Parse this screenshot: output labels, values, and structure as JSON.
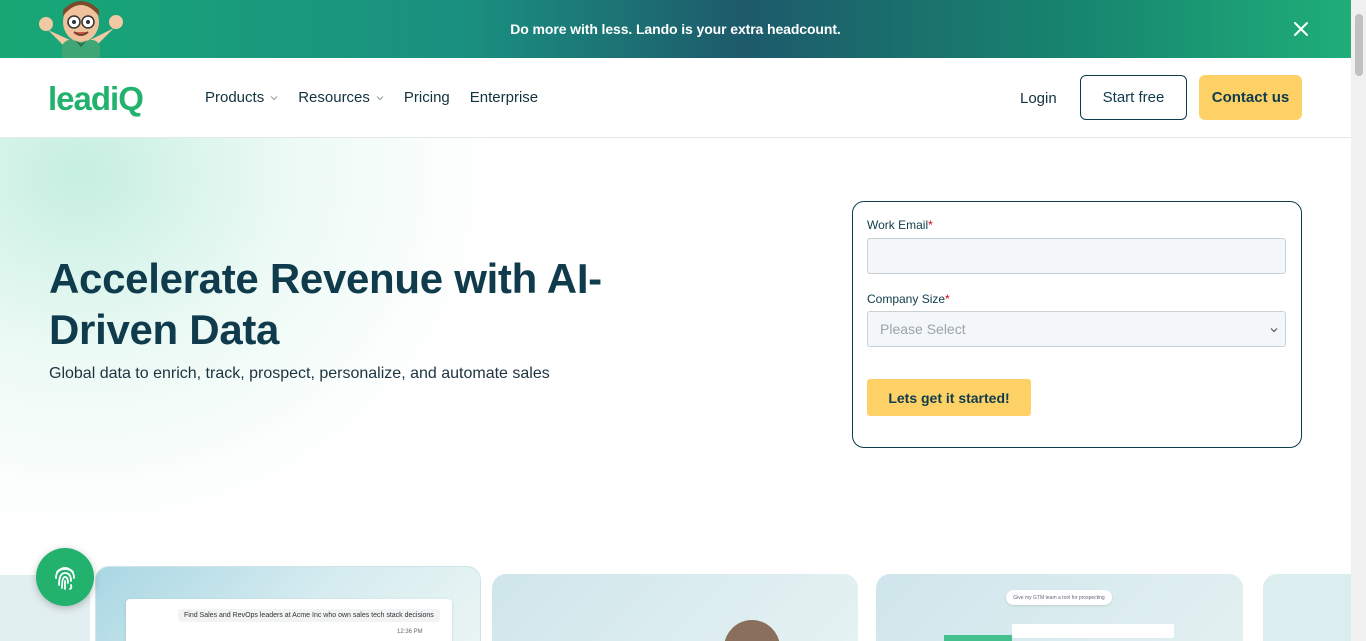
{
  "banner": {
    "text": "Do more with less. Lando is your extra headcount.",
    "close_icon": "close-icon",
    "mascot_icon": "mascot-icon"
  },
  "nav": {
    "logo_text": "leadiQ",
    "items": [
      {
        "label": "Products",
        "has_dropdown": true
      },
      {
        "label": "Resources",
        "has_dropdown": true
      },
      {
        "label": "Pricing",
        "has_dropdown": false
      },
      {
        "label": "Enterprise",
        "has_dropdown": false
      }
    ],
    "login_label": "Login",
    "start_free_label": "Start free",
    "contact_label": "Contact us"
  },
  "hero": {
    "title": "Accelerate Revenue with AI-Driven Data",
    "subtitle": "Global data to enrich, track, prospect, personalize, and automate sales"
  },
  "form": {
    "email_label": "Work Email",
    "email_value": "",
    "required_mark": "*",
    "size_label": "Company Size",
    "size_value": "Please Select",
    "submit_label": "Lets get it started!"
  },
  "cards": {
    "chat_message": "Find Sales and RevOps leaders at Acme Inc who own sales tech stack decisions",
    "chat_time": "12:36 PM",
    "prompt_pill": "Give my GTM team a tool for prospecting"
  },
  "fab": {
    "icon": "fingerprint-icon"
  },
  "colors": {
    "brand_green": "#22b26e",
    "navy": "#0f3b4c",
    "accent_yellow": "#fdd166",
    "required_red": "#d0021b"
  }
}
